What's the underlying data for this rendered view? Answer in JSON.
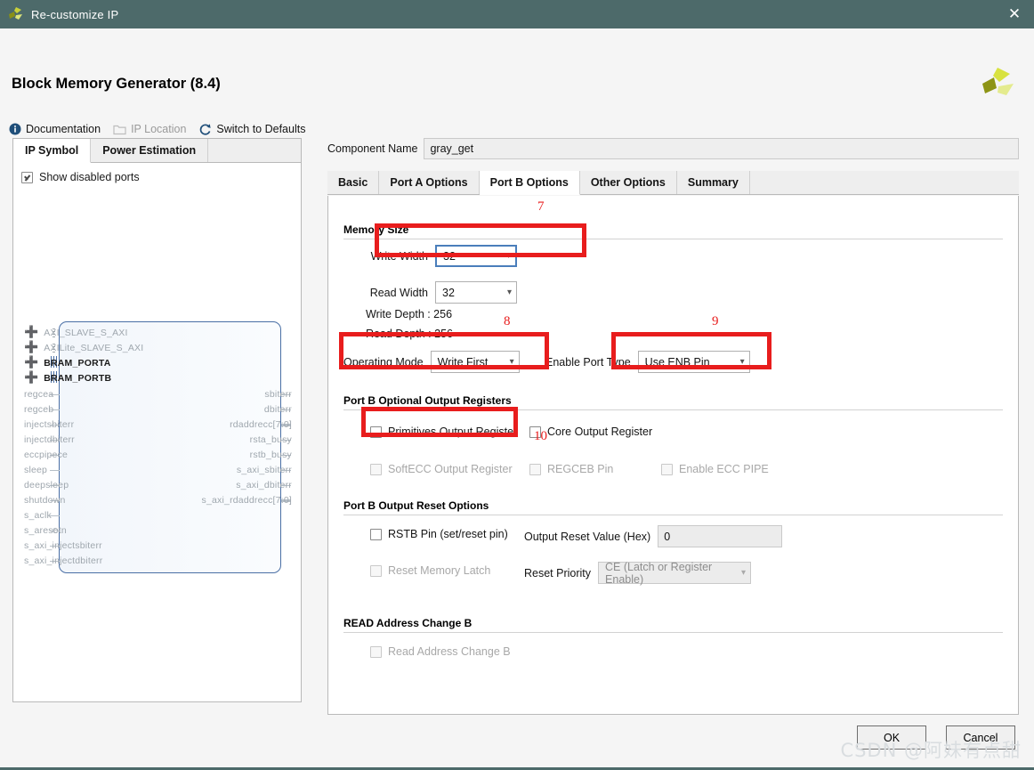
{
  "window": {
    "title": "Re-customize IP",
    "close_icon": "close-icon",
    "logo_icon": "xilinx-logo-icon"
  },
  "header": {
    "page_title": "Block Memory Generator (8.4)",
    "brand_logo_icon": "xilinx-brand-logo-icon"
  },
  "links": [
    {
      "label": "Documentation",
      "icon": "info-icon",
      "enabled": true
    },
    {
      "label": "IP Location",
      "icon": "folder-icon",
      "enabled": false
    },
    {
      "label": "Switch to Defaults",
      "icon": "refresh-icon",
      "enabled": true
    }
  ],
  "left_panel": {
    "tabs": [
      {
        "label": "IP Symbol",
        "active": true
      },
      {
        "label": "Power Estimation",
        "active": false
      }
    ],
    "show_disabled_ports": {
      "label": "Show disabled ports",
      "checked": true
    },
    "symbol": {
      "buses": [
        {
          "name": "AXI_SLAVE_S_AXI",
          "enabled": false
        },
        {
          "name": "AXILite_SLAVE_S_AXI",
          "enabled": false
        },
        {
          "name": "BRAM_PORTA",
          "enabled": true
        },
        {
          "name": "BRAM_PORTB",
          "enabled": true
        }
      ],
      "inputs": [
        "regcea",
        "regceb",
        "injectsbiterr",
        "injectdbiterr",
        "eccpipece",
        "sleep",
        "deepsleep",
        "shutdown",
        "s_aclk",
        "s_aresetn",
        "s_axi_injectsbiterr",
        "s_axi_injectdbiterr"
      ],
      "outputs": [
        {
          "name": "sbiterr",
          "bus": false
        },
        {
          "name": "dbiterr",
          "bus": false
        },
        {
          "name": "rdaddrecc[7:0]",
          "bus": true
        },
        {
          "name": "rsta_busy",
          "bus": false
        },
        {
          "name": "rstb_busy",
          "bus": false
        },
        {
          "name": "s_axi_sbiterr",
          "bus": false
        },
        {
          "name": "s_axi_dbiterr",
          "bus": false
        },
        {
          "name": "s_axi_rdaddrecc[7:0]",
          "bus": true
        }
      ]
    }
  },
  "main": {
    "component_name": {
      "label": "Component Name",
      "value": "gray_get"
    },
    "tabs": [
      {
        "label": "Basic",
        "active": false
      },
      {
        "label": "Port A Options",
        "active": false
      },
      {
        "label": "Port B Options",
        "active": true
      },
      {
        "label": "Other Options",
        "active": false
      },
      {
        "label": "Summary",
        "active": false
      }
    ],
    "memory_size": {
      "title": "Memory Size",
      "write_width": {
        "label": "Write Width",
        "value": "32",
        "focused": true
      },
      "read_width": {
        "label": "Read Width",
        "value": "32",
        "focused": false
      },
      "write_depth": "Write Depth : 256",
      "read_depth": "Read Depth : 256",
      "operating_mode": {
        "label": "Operating Mode",
        "value": "Write First"
      },
      "enable_port_type": {
        "label": "Enable Port Type",
        "value": "Use ENB Pin"
      }
    },
    "optional_output_registers": {
      "title": "Port B Optional Output Registers",
      "items": [
        {
          "label": "Primitives Output Register",
          "checked": false,
          "enabled": true
        },
        {
          "label": "Core Output Register",
          "checked": false,
          "enabled": true
        },
        {
          "label": "SoftECC Output Register",
          "checked": false,
          "enabled": false
        },
        {
          "label": "REGCEB Pin",
          "checked": false,
          "enabled": false
        },
        {
          "label": "Enable ECC PIPE",
          "checked": false,
          "enabled": false
        }
      ]
    },
    "output_reset_options": {
      "title": "Port B Output Reset Options",
      "rstb_pin": {
        "label": "RSTB Pin (set/reset pin)",
        "checked": false,
        "enabled": true
      },
      "reset_memory_latch": {
        "label": "Reset Memory Latch",
        "checked": false,
        "enabled": false
      },
      "output_reset_value": {
        "label": "Output Reset Value (Hex)",
        "value": "0"
      },
      "reset_priority": {
        "label": "Reset Priority",
        "value": "CE (Latch or Register Enable)"
      }
    },
    "read_address_change": {
      "title": "READ Address Change B",
      "checkbox": {
        "label": "Read Address Change B",
        "checked": false,
        "enabled": false
      }
    }
  },
  "annotations": {
    "color": "#e81d1d",
    "numbers": [
      "7",
      "8",
      "9",
      "10"
    ]
  },
  "footer": {
    "ok_label": "OK",
    "cancel_label": "Cancel",
    "watermark": "CSDN @阿妹有点甜"
  }
}
